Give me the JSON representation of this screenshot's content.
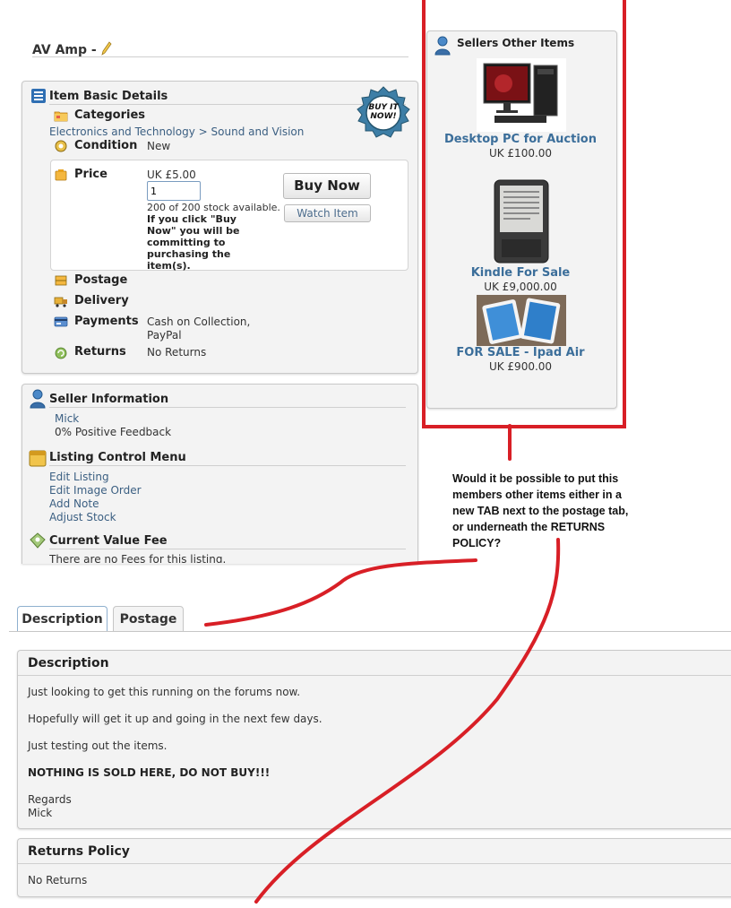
{
  "listing": {
    "title": "AV Amp -"
  },
  "basic": {
    "header": "Item Basic Details",
    "badge_line1": "BUY IT",
    "badge_line2": "NOW!",
    "categories_label": "Categories",
    "category_path": [
      "Electronics and Technology",
      ">",
      "Sound and Vision"
    ],
    "condition_label": "Condition",
    "condition_value": "New",
    "price_label": "Price",
    "price_value": "UK £5.00",
    "quantity": "1",
    "stock_note": "200 of 200 stock available.",
    "commit_note": "If you click \"Buy Now\" you will be committing to purchasing the item(s).",
    "buy_now": "Buy Now",
    "watch_item": "Watch Item",
    "postage_label": "Postage",
    "delivery_label": "Delivery",
    "payments_label": "Payments",
    "payments_value1": "Cash on Collection,",
    "payments_value2": "PayPal",
    "returns_label": "Returns",
    "returns_value": "No Returns"
  },
  "seller": {
    "header": "Seller Information",
    "name": "Mick",
    "feedback": "0% Positive Feedback",
    "control_header": "Listing Control Menu",
    "controls": [
      "Edit Listing",
      "Edit Image Order",
      "Add Note",
      "Adjust Stock"
    ],
    "fee_header": "Current Value Fee",
    "fee_text": "There are no Fees for this listing."
  },
  "other_items": {
    "header": "Sellers Other Items",
    "items": [
      {
        "title": "Desktop PC for Auction",
        "price": "UK £100.00"
      },
      {
        "title": "Kindle For Sale",
        "price": "UK £9,000.00"
      },
      {
        "title": "FOR SALE - Ipad Air",
        "price": "UK £900.00"
      }
    ]
  },
  "annotation": {
    "lines": [
      "Would it be possible to put this",
      "members other items either in a",
      "new TAB next to the postage tab,",
      "or underneath the RETURNS",
      "POLICY?"
    ],
    "color": "#d81f26"
  },
  "tabs": [
    "Description",
    "Postage"
  ],
  "description": {
    "header": "Description",
    "p1": "Just looking to get this running on the forums now.",
    "p2": "Hopefully will get it up and going in the next few days.",
    "p3": "Just testing out the items.",
    "p4": "NOTHING IS SOLD HERE, DO NOT BUY!!!",
    "p5a": "Regards",
    "p5b": "Mick"
  },
  "returns_policy": {
    "header": "Returns Policy",
    "text": "No Returns"
  }
}
